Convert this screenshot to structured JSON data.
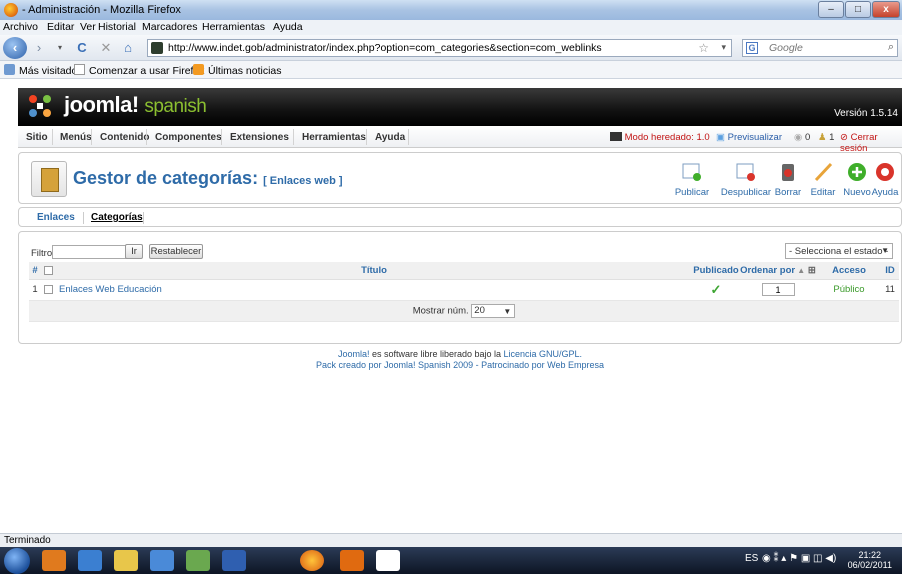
{
  "window": {
    "title": "- Administración - Mozilla Firefox",
    "min": "–",
    "max": "□",
    "close": "x"
  },
  "menubar": [
    "Archivo",
    "Editar",
    "Ver",
    "Historial",
    "Marcadores",
    "Herramientas",
    "Ayuda"
  ],
  "navbar": {
    "url": "http://www.indet.gob/administrator/index.php?option=com_categories&section=com_weblinks",
    "search_placeholder": "Google"
  },
  "bookmarks": [
    "Más visitados",
    "Comenzar a usar Firefox",
    "Últimas noticias"
  ],
  "joomla": {
    "logo": "joomla!",
    "logo_sub": "spanish",
    "version": "Versión 1.5.14",
    "menu": [
      "Sitio",
      "Menús",
      "Contenido",
      "Componentes",
      "Extensiones",
      "Herramientas",
      "Ayuda"
    ],
    "status": {
      "legacy": "Modo heredado: 1.0",
      "preview": "Previsualizar",
      "messages": "0",
      "users": "1",
      "logout": "Cerrar sesión"
    },
    "page_title": "Gestor de categorías:",
    "page_subtitle": "[ Enlaces web ]",
    "toolbar": [
      "Publicar",
      "Despublicar",
      "Borrar",
      "Editar",
      "Nuevo",
      "Ayuda"
    ],
    "tabs": [
      "Enlaces",
      "Categorías"
    ],
    "filter": {
      "label": "Filtro:",
      "value": "",
      "go": "Ir",
      "reset": "Restablecer",
      "state": "- Selecciona el estado -"
    },
    "table": {
      "headers": [
        "#",
        "Título",
        "Publicado",
        "Ordenar por",
        "Acceso",
        "ID"
      ],
      "rows": [
        {
          "num": "1",
          "title": "Enlaces Web Educación",
          "published": true,
          "order": "1",
          "access": "Público",
          "id": "11"
        }
      ],
      "limit_label": "Mostrar núm.",
      "limit_value": "20"
    },
    "footer": {
      "line1_brand": "Joomla!",
      "line1_mid": " es software libre liberado bajo la ",
      "line1_link": "Licencia GNU/GPL.",
      "line2": "Pack creado por Joomla! Spanish 2009 - Patrocinado por Web Empresa"
    }
  },
  "statusbar": "Terminado",
  "taskbar": {
    "lang": "ES",
    "time": "21:22",
    "date": "06/02/2011"
  }
}
